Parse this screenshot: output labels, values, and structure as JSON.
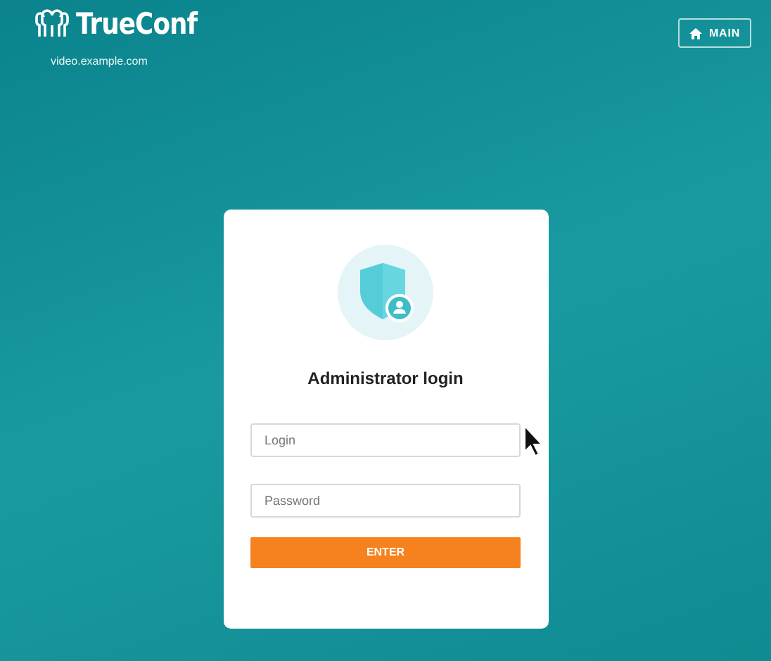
{
  "header": {
    "logo_text": "TrueConf",
    "domain": "video.example.com",
    "main_button": "MAIN"
  },
  "login_card": {
    "title": "Administrator login",
    "fields": [
      {
        "placeholder": "Login"
      },
      {
        "placeholder": "Password"
      }
    ],
    "submit": "ENTER"
  }
}
